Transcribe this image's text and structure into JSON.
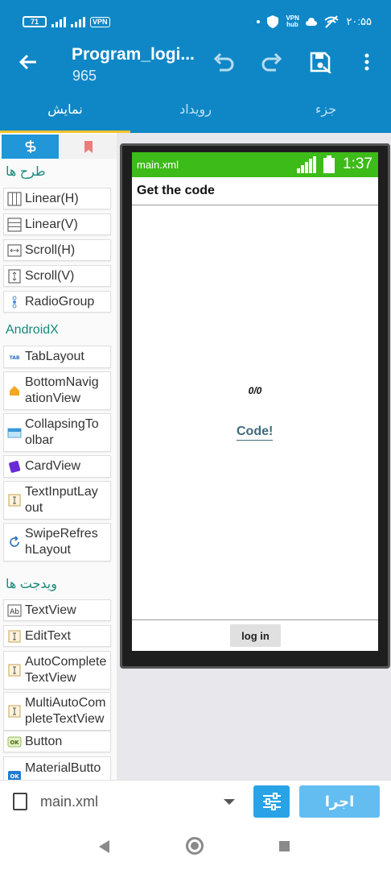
{
  "status_bar": {
    "battery": "71",
    "vpn": "VPN",
    "vpn_hub": "VPN hub",
    "time": "۲۰:۵۵"
  },
  "app_bar": {
    "title": "Program_logi...",
    "subtitle": "965"
  },
  "tabs": [
    {
      "label": "نمایش",
      "active": true
    },
    {
      "label": "رویداد",
      "active": false
    },
    {
      "label": "جزء",
      "active": false
    }
  ],
  "palette": {
    "section_layouts": "طرح ها",
    "layouts": [
      "Linear(H)",
      "Linear(V)",
      "Scroll(H)",
      "Scroll(V)",
      "RadioGroup"
    ],
    "section_androidx": "AndroidX",
    "androidx": [
      "TabLayout",
      "BottomNavig ationView",
      "CollapsingTo olbar",
      "CardView",
      "TextInputLay out",
      "SwipeRefres hLayout"
    ],
    "section_widgets": "ویدجت ها",
    "widgets": [
      "TextView",
      "EditText",
      "AutoComplete TextView",
      "MultiAutoCom pleteTextView",
      "Button",
      "MaterialButto"
    ]
  },
  "preview": {
    "file_name": "main.xml",
    "time": "1:37",
    "screen_title": "Get the code",
    "counter": "0/0",
    "code_link": "Code!",
    "login_button": "log in"
  },
  "bottom_bar": {
    "file_name": "main.xml",
    "run_label": "اجرا"
  },
  "colors": {
    "primary": "#0f87c6",
    "tab_indicator": "#f6c32b",
    "device_status": "#3dbb19",
    "section_text": "#178a7b",
    "run_button": "#64bdf0"
  }
}
